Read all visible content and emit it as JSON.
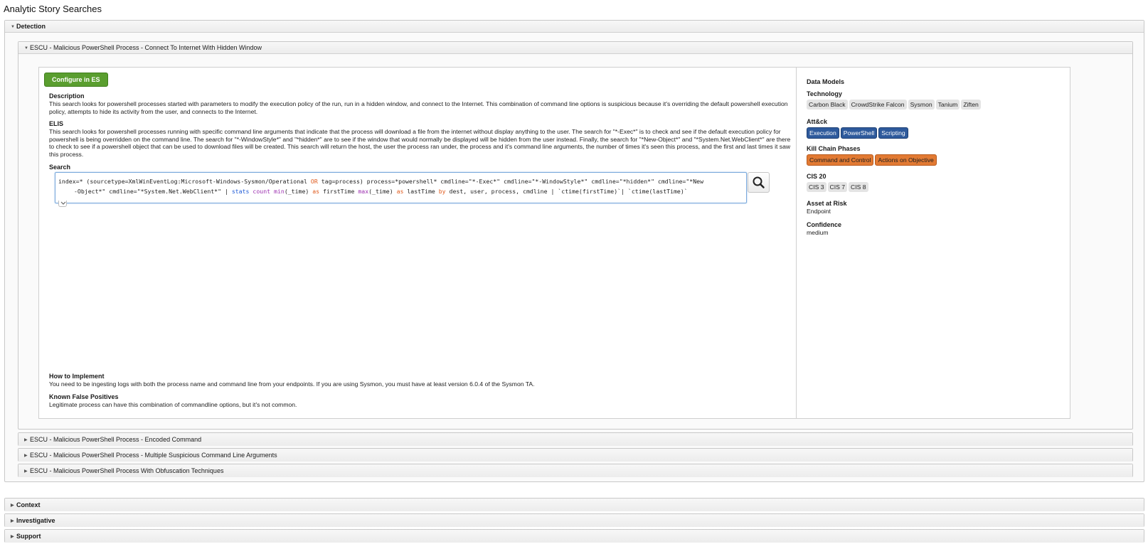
{
  "page_title": "Analytic Story Searches",
  "sections": {
    "detection": "Detection",
    "context": "Context",
    "investigative": "Investigative",
    "support": "Support"
  },
  "open_search": {
    "title": "ESCU - Malicious PowerShell Process - Connect To Internet With Hidden Window",
    "configure_label": "Configure in ES",
    "description_label": "Description",
    "description": "This search looks for powershell processes started with parameters to modify the execution policy of the run, run in a hidden window, and connect to the Internet. This combination of command line options is suspicious because it's overriding the default powershell execution policy, attempts to hide its activity from the user, and connects to the Internet.",
    "elis_label": "ELIS",
    "elis": "This search looks for powershell processes running with specific command line arguments that indicate that the process will download a file from the internet without display anything to the user. The search for \"*-Exec*\" is to check and see if the default execution policy for powershell is being overridden on the command line. The search for \"*-WindowStyle*\" and \"*hidden*\" are to see if the window that would normally be displayed will be hidden from the user instead. Finally, the search for \"*New-Object*\" and \"*System.Net.WebClient*\" are there to check to see if a powershell object that can be used to download files will be created. This search will return the host, the user the process ran under, the process and it's command line arguments, the number of times it's seen this process, and the first and last times it saw this process.",
    "search_label": "Search",
    "query": {
      "p1": "index=* (sourcetype=XmlWinEventLog:Microsoft-Windows-Sysmon/Operational ",
      "or": "OR",
      "p2": " tag=process) process=*powershell* cmdline=\"*-Exec*\" cmdline=\"*-WindowStyle*\" cmdline=\"*hidden*\" cmdline=\"*New",
      "p3": "-Object*\" cmdline=\"*System.Net.WebClient*\" | ",
      "stats": "stats",
      "sp1": " ",
      "count": "count",
      "sp2": " ",
      "min": "min",
      "p4": "(_time) ",
      "as1": "as",
      "p5": " firstTime ",
      "max": "max",
      "p6": "(_time) ",
      "as2": "as",
      "p7": " lastTime ",
      "by": "by",
      "p8": " dest, user, process, cmdline | `ctime(firstTime)`| `ctime(lastTime)`"
    },
    "how_to_label": "How to Implement",
    "how_to": "You need to be ingesting logs with both the process name and command line from your endpoints. If you are using Sysmon, you must have at least version 6.0.4 of the Sysmon TA.",
    "fp_label": "Known False Positives",
    "fp": "Legitimate process can have this combination of commandline options, but it's not common."
  },
  "sidebar": {
    "data_models_label": "Data Models",
    "technology_label": "Technology",
    "technology": [
      "Carbon Black",
      "CrowdStrike Falcon",
      "Sysmon",
      "Tanium",
      "Ziften"
    ],
    "attack_label": "Att&ck",
    "attack": [
      "Execution",
      "PowerShell",
      "Scripting"
    ],
    "kill_chain_label": "Kill Chain Phases",
    "kill_chain": [
      "Command and Control",
      "Actions on Objective"
    ],
    "cis_label": "CIS 20",
    "cis": [
      "CIS 3",
      "CIS 7",
      "CIS 8"
    ],
    "asset_label": "Asset at Risk",
    "asset": "Endpoint",
    "confidence_label": "Confidence",
    "confidence": "medium"
  },
  "other_searches": [
    "ESCU - Malicious PowerShell Process - Encoded Command",
    "ESCU - Malicious PowerShell Process - Multiple Suspicious Command Line Arguments",
    "ESCU - Malicious PowerShell Process With Obfuscation Techniques"
  ],
  "colors": {
    "accent_green": "#5a9e2f",
    "attack_blue": "#2e5a9c",
    "killchain_orange": "#e27a33",
    "tag_gray": "#e4e4e4"
  }
}
